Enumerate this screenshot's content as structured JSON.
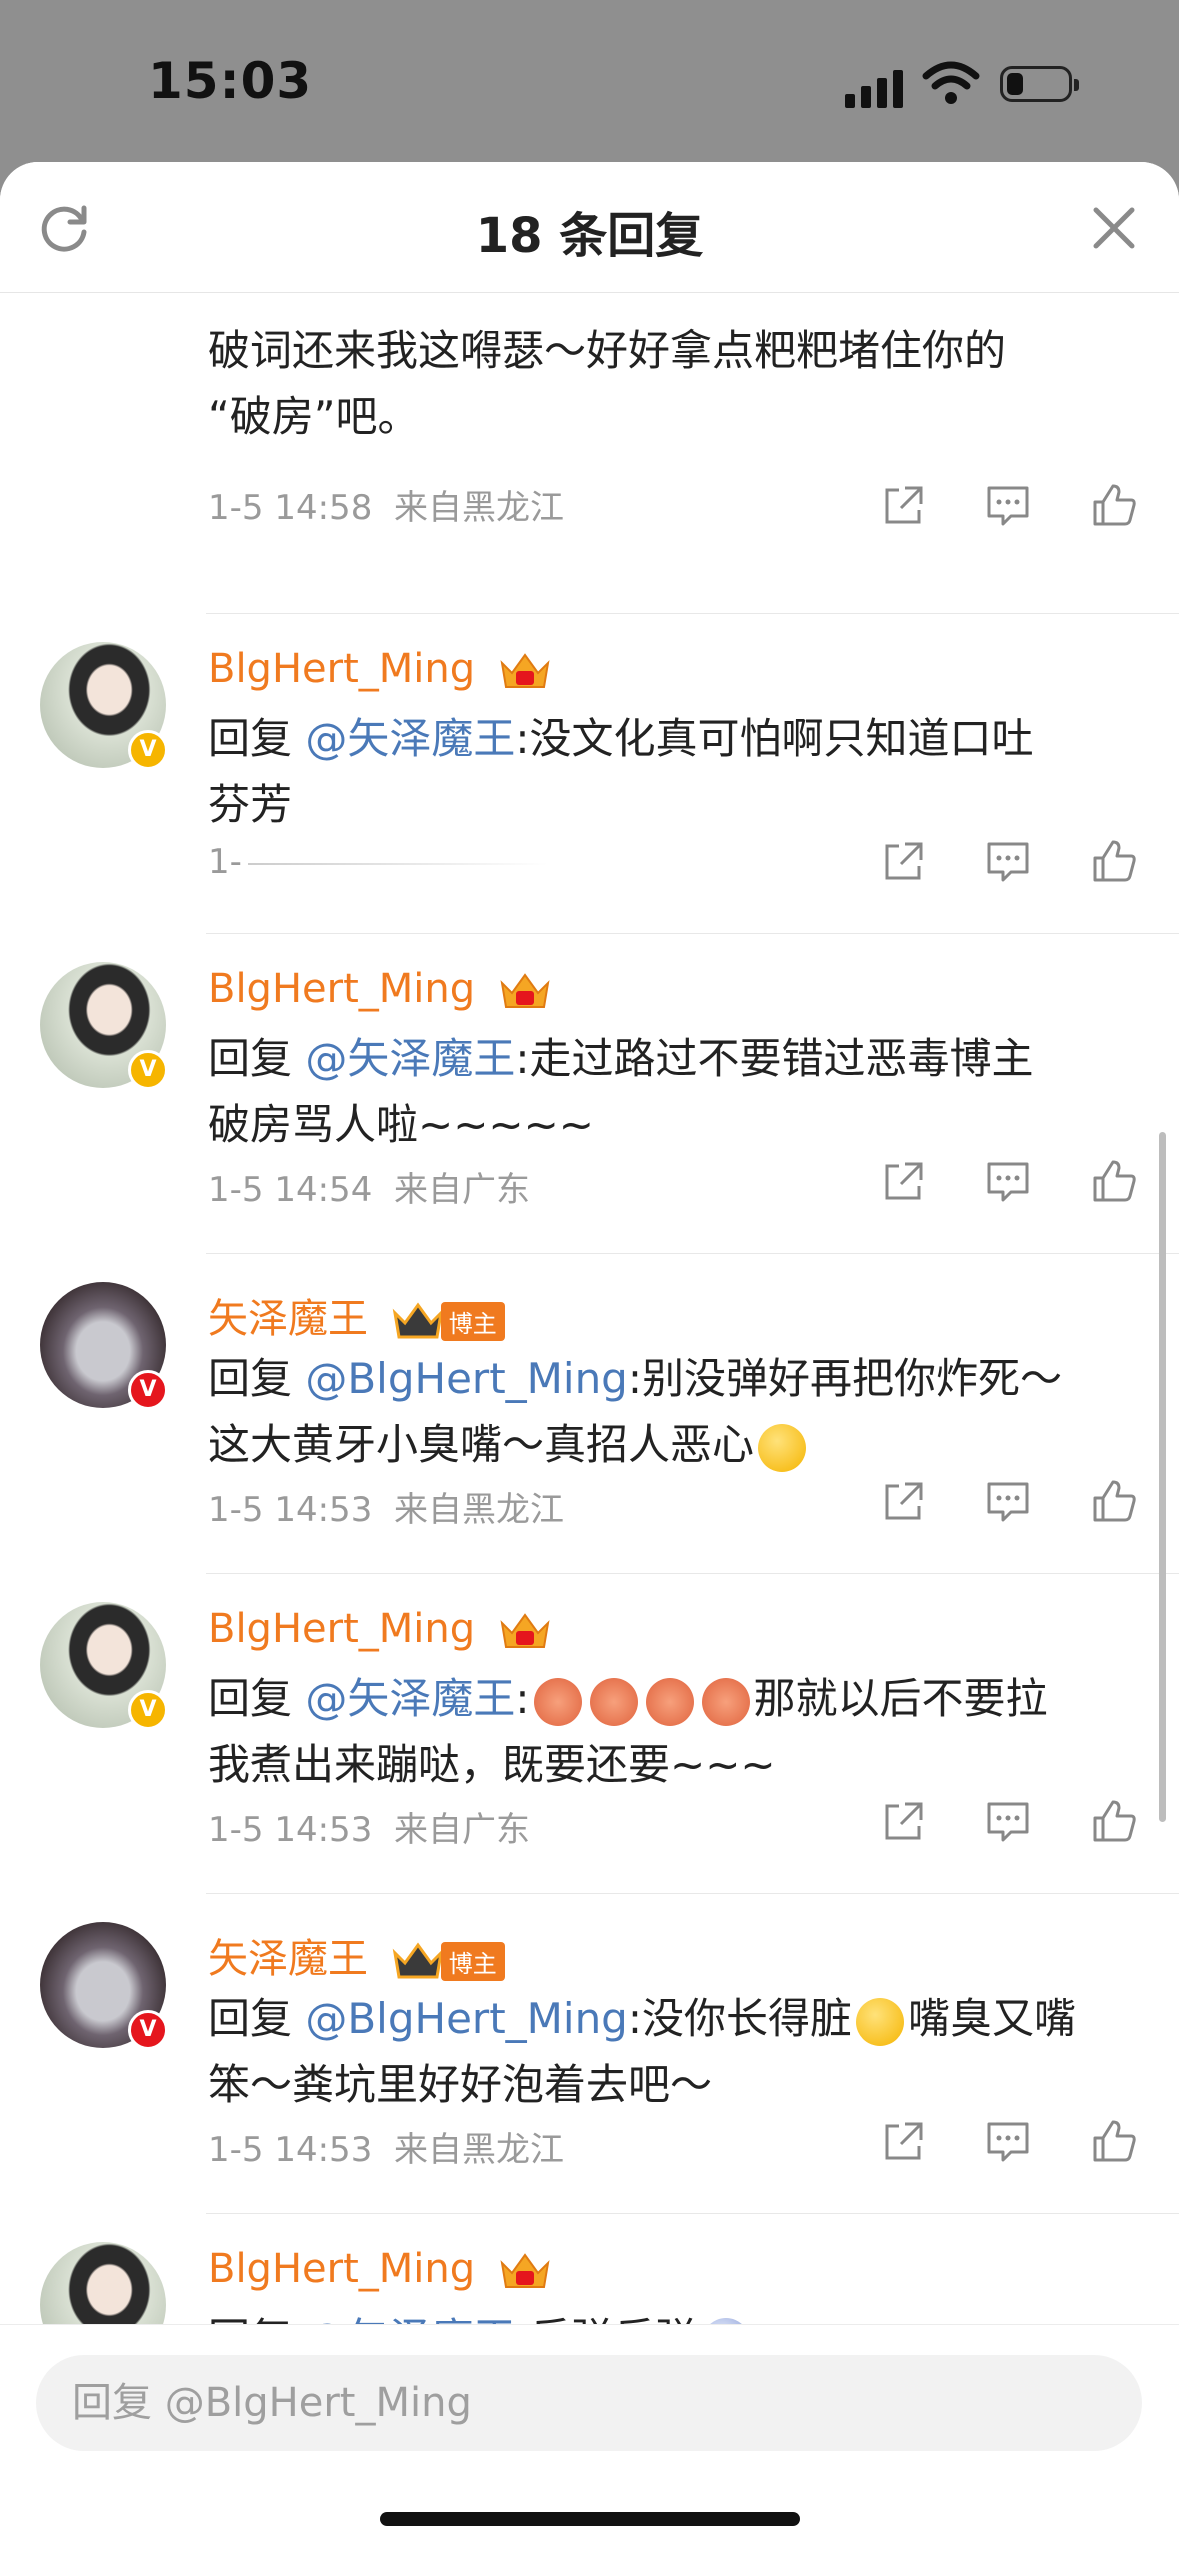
{
  "status_bar": {
    "time": "15:03"
  },
  "header": {
    "title": "18 条回复"
  },
  "reply_placeholder": "回复 @BlgHert_Ming",
  "host_tag": "博主",
  "comments": [
    {
      "line1": "破词还来我这嘚瑟～好好拿点粑粑堵住你的",
      "line2": "“破房”吧。",
      "date": "1-5 14:58",
      "location": "来自黑龙江"
    },
    {
      "user": "BlgHert_Ming",
      "reply_prefix": "回复 ",
      "mention": "@矢泽魔王",
      "text": ":没文化真可怕啊只知道口吐",
      "text2": "芬芳",
      "date": "1-",
      "location": ""
    },
    {
      "user": "BlgHert_Ming",
      "reply_prefix": "回复 ",
      "mention": "@矢泽魔王",
      "text": ":走过路过不要错过恶毒博主",
      "text2": "破房骂人啦~~~~~",
      "date": "1-5 14:54",
      "location": "来自广东"
    },
    {
      "user": "矢泽魔王",
      "reply_prefix": "回复 ",
      "mention": "@BlgHert_Ming",
      "text": ":别没弹好再把你炸死～",
      "text2": "这大黄牙小臭嘴～真招人恶心",
      "date": "1-5 14:53",
      "location": "来自黑龙江"
    },
    {
      "user": "BlgHert_Ming",
      "reply_prefix": "回复 ",
      "mention": "@矢泽魔王",
      "text": "那就以后不要拉",
      "text2": "我煮出来蹦哒，既要还要~~~",
      "date": "1-5 14:53",
      "location": "来自广东"
    },
    {
      "user": "矢泽魔王",
      "reply_prefix": "回复 ",
      "mention": "@BlgHert_Ming",
      "text": ":没你长得脏",
      "text_b": "嘴臭又嘴",
      "text2": "笨～粪坑里好好泡着去吧～",
      "date": "1-5 14:53",
      "location": "来自黑龙江"
    },
    {
      "user": "BlgHert_Ming",
      "reply_prefix": "回复 ",
      "mention": "@矢泽魔王",
      "text": ":反弹反弹",
      "text_b": "~~~~~~~"
    }
  ],
  "colors": {
    "username": "#f07a1f",
    "mention": "#4a79b8",
    "meta": "#9a9a9a",
    "vip_gold": "#f6b500",
    "verified_red": "#e5161d"
  },
  "icons": [
    "refresh-icon",
    "close-icon",
    "share-icon",
    "comment-icon",
    "like-icon",
    "crown-icon",
    "signal-icon",
    "wifi-icon",
    "battery-icon"
  ]
}
